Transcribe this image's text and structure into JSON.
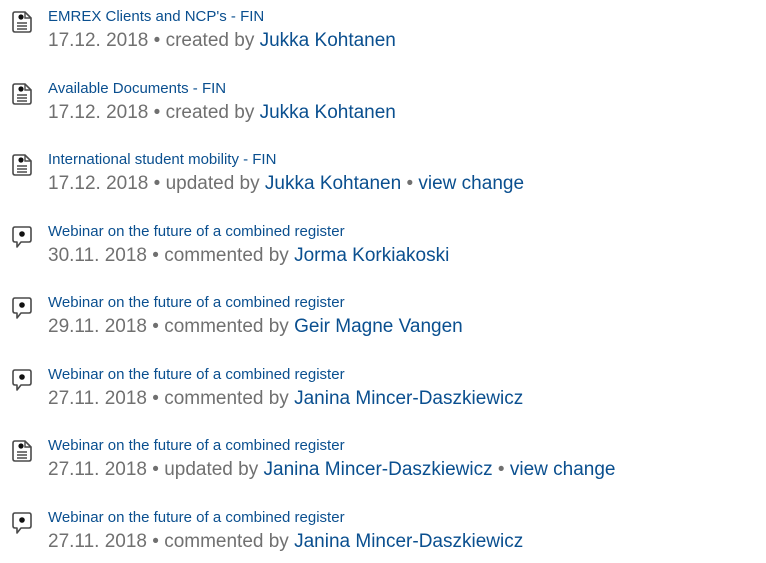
{
  "activity": [
    {
      "type": "page",
      "icon": "page-icon",
      "title": "EMREX Clients and NCP's - FIN",
      "date": "17.12. 2018",
      "action": "created by",
      "user": "Jukka Kohtanen",
      "change_link": ""
    },
    {
      "type": "page",
      "icon": "page-icon",
      "title": "Available Documents - FIN",
      "date": "17.12. 2018",
      "action": "created by",
      "user": "Jukka Kohtanen",
      "change_link": ""
    },
    {
      "type": "page",
      "icon": "page-icon",
      "title": "International student mobility - FIN",
      "date": "17.12. 2018",
      "action": "updated by",
      "user": "Jukka Kohtanen",
      "change_link": "view change"
    },
    {
      "type": "comment",
      "icon": "comment-icon",
      "title": "Webinar on the future of a combined register",
      "date": "30.11. 2018",
      "action": "commented by",
      "user": "Jorma Korkiakoski",
      "change_link": ""
    },
    {
      "type": "comment",
      "icon": "comment-icon",
      "title": "Webinar on the future of a combined register",
      "date": "29.11. 2018",
      "action": "commented by",
      "user": "Geir Magne Vangen",
      "change_link": ""
    },
    {
      "type": "comment",
      "icon": "comment-icon",
      "title": "Webinar on the future of a combined register",
      "date": "27.11. 2018",
      "action": "commented by",
      "user": "Janina Mincer-Daszkiewicz",
      "change_link": ""
    },
    {
      "type": "page",
      "icon": "page-icon",
      "title": "Webinar on the future of a combined register",
      "date": "27.11. 2018",
      "action": "updated by",
      "user": "Janina Mincer-Daszkiewicz",
      "change_link": "view change"
    },
    {
      "type": "comment",
      "icon": "comment-icon",
      "title": "Webinar on the future of a combined register",
      "date": "27.11. 2018",
      "action": "commented by",
      "user": "Janina Mincer-Daszkiewicz",
      "change_link": ""
    }
  ],
  "separator": "•",
  "colors": {
    "link": "#0a4f8f",
    "meta_text": "#707070",
    "icon_stroke": "#4a4a4a"
  }
}
